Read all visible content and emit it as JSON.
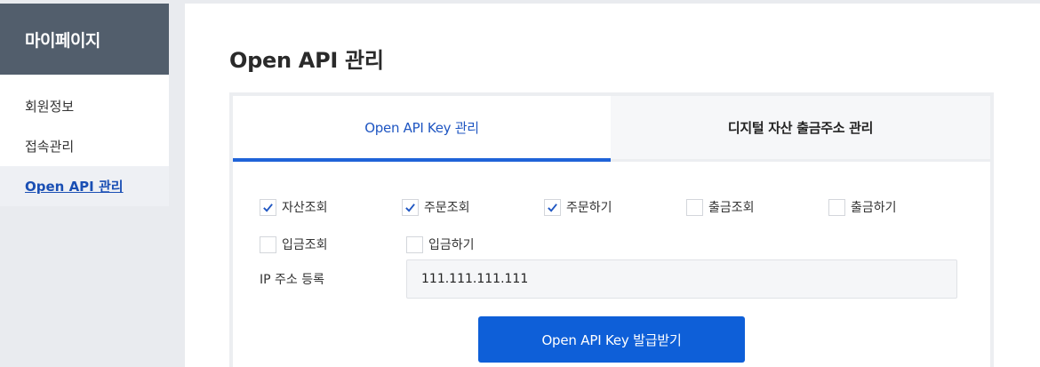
{
  "sidebar": {
    "title": "마이페이지",
    "items": [
      {
        "label": "회원정보",
        "active": false
      },
      {
        "label": "접속관리",
        "active": false
      },
      {
        "label": "Open API 관리",
        "active": true
      }
    ]
  },
  "main": {
    "title": "Open API 관리",
    "tabs": [
      {
        "label": "Open API Key 관리",
        "active": true
      },
      {
        "label": "디지털 자산 출금주소 관리",
        "active": false
      }
    ],
    "permissions": [
      {
        "label": "자산조회",
        "checked": true
      },
      {
        "label": "주문조회",
        "checked": true
      },
      {
        "label": "주문하기",
        "checked": true
      },
      {
        "label": "출금조회",
        "checked": false
      },
      {
        "label": "출금하기",
        "checked": false
      },
      {
        "label": "입금조회",
        "checked": false
      },
      {
        "label": "입금하기",
        "checked": false
      }
    ],
    "ip": {
      "label": "IP 주소 등록",
      "value": "111.111.111.111"
    },
    "issue_button_label": "Open API Key 발급받기"
  },
  "colors": {
    "accent": "#0e5fd8",
    "sidebar_header": "#525e6c",
    "check": "#1f56c2"
  }
}
